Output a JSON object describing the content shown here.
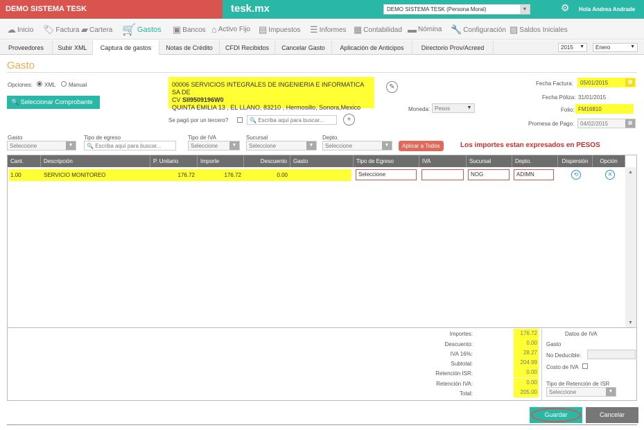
{
  "header": {
    "brand_left": "DEMO SISTEMA TESK",
    "brand_center": "tesk.mx",
    "company": "DEMO SISTEMA TESK (Persona Moral)",
    "greeting": "Hola Andrea Andrade"
  },
  "nav": [
    {
      "label": "Inicio",
      "icon": "cloud-icon"
    },
    {
      "label": "Factura",
      "icon": "tag-icon"
    },
    {
      "label": "Cartera",
      "icon": "briefcase-icon"
    },
    {
      "label": "Gastos",
      "icon": "cart-icon"
    },
    {
      "label": "Bancos",
      "icon": "bank-icon"
    },
    {
      "label": "Activo Fijo",
      "icon": "house-icon"
    },
    {
      "label": "Impuestos",
      "icon": "tax-icon"
    },
    {
      "label": "Informes",
      "icon": "report-icon"
    },
    {
      "label": "Contabilidad",
      "icon": "ledger-icon"
    },
    {
      "label": "Nómina",
      "icon": "card-icon"
    },
    {
      "label": "Configuración",
      "icon": "wrench-icon"
    },
    {
      "label": "Saldos Iniciales",
      "icon": "balance-icon"
    }
  ],
  "subtabs": [
    "Proveedores",
    "Subir XML",
    "Captura de gastos",
    "Notas de Crédito",
    "CFDI Recibidos",
    "Cancelar Gasto",
    "Aplicación de Anticipos",
    "Directorio Prov/Acreed"
  ],
  "year": "2015",
  "month": "Enero",
  "page_title": "Gasto",
  "options": {
    "label": "Opciones:",
    "xml": "XML",
    "manual": "Manual"
  },
  "select_voucher": "Seleccionar Comprobante",
  "supplier": {
    "line1": "00006 SERVICIOS INTEGRALES DE INGENIERIA E INFORMATICA SA DE",
    "line2_prefix": "CV",
    "rfc": "SII9509196W0",
    "line3": "QUINTA EMILIA 13 , EL LLANO, 83210 , Hermosillo, Sonora,Mexico"
  },
  "third_party_label": "Se pagó por un tercero?",
  "search_placeholder": "Escriba aquí para buscar...",
  "currency": {
    "label": "Moneda:",
    "value": "Pesos"
  },
  "fecha_factura": {
    "label": "Fecha Factura:",
    "value": "05/01/2015"
  },
  "fecha_poliza": {
    "label": "Fecha Póliza:",
    "value": "31/01/2015"
  },
  "folio": {
    "label": "Folio:",
    "value": "FM16810"
  },
  "promesa_pago": {
    "label": "Promesa de Pago:",
    "value": "04/02/2015"
  },
  "filters": {
    "gasto": {
      "label": "Gasto",
      "value": "Seleccione"
    },
    "tipo_egreso": {
      "label": "Tipo de egreso",
      "placeholder": "Escriba aquí para buscar..."
    },
    "tipo_iva": {
      "label": "Tipo de IVA",
      "value": "Seleccione"
    },
    "sucursal": {
      "label": "Sucursal",
      "value": "Seleccione"
    },
    "depto": {
      "label": "Depto.",
      "value": "Seleccione"
    },
    "apply_all": "Aplicar a Todos"
  },
  "note": "Los importes estan expresados en PESOS",
  "columns": [
    "Cant.",
    "Descripción",
    "P. Unitario",
    "Importe",
    "Descuento",
    "Gasto",
    "Tipo de Egreso",
    "IVA",
    "Sucursal",
    "Depto.",
    "Dispersión",
    "Opción"
  ],
  "rows": [
    {
      "cant": "1.00",
      "descripcion": "SERVICIO MONITOREO",
      "p_unitario": "176.72",
      "importe": "176.72",
      "descuento": "0.00",
      "gasto": "",
      "tipo_egreso": "Seleccione",
      "iva": "",
      "sucursal": "NOG",
      "depto": "ADIMN"
    }
  ],
  "totals": [
    {
      "label": "Importes:",
      "value": "176.72"
    },
    {
      "label": "Descuento:",
      "value": "0.00"
    },
    {
      "label": "IVA 16%:",
      "value": "28.27"
    },
    {
      "label": "Subtotal:",
      "value": "204.99"
    },
    {
      "label": "Retención ISR:",
      "value": "0.00"
    },
    {
      "label": "Retención IVA:",
      "value": "0.00"
    },
    {
      "label": "Total:",
      "value": "205.00"
    }
  ],
  "iva_panel": {
    "title": "Datos de IVA",
    "gasto": "Gasto",
    "no_deducible": "No Deducible:",
    "costo_iva": "Costo de IVA",
    "tipo_retencion": "Tipo de Retención de ISR",
    "retencion_value": "Seleccione"
  },
  "buttons": {
    "save": "Guardar",
    "cancel": "Cancelar"
  }
}
